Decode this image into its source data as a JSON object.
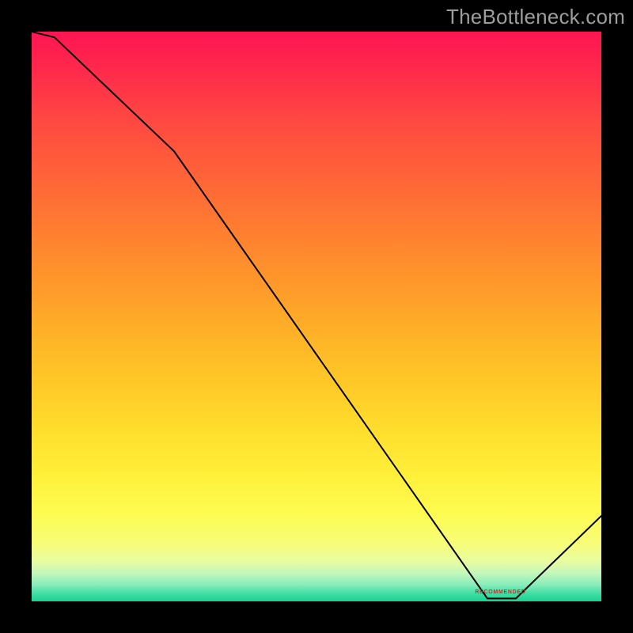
{
  "attribution": "TheBottleneck.com",
  "baseline_label": "RECOMMENDED",
  "chart_data": {
    "type": "line",
    "title": "",
    "xlabel": "",
    "ylabel": "",
    "xlim": [
      0,
      100
    ],
    "ylim": [
      0,
      100
    ],
    "grid": false,
    "x": [
      0,
      4,
      25,
      80,
      85,
      100
    ],
    "values": [
      100,
      99,
      79,
      0.5,
      0.5,
      15
    ],
    "background_gradient": {
      "orientation": "vertical",
      "stops": [
        {
          "pos": 0.0,
          "color": "#ff1552"
        },
        {
          "pos": 0.5,
          "color": "#ffb427"
        },
        {
          "pos": 0.85,
          "color": "#fdfc53"
        },
        {
          "pos": 1.0,
          "color": "#16d393"
        }
      ]
    },
    "annotations": [
      {
        "text": "RECOMMENDED",
        "x": 82,
        "y": 1.5,
        "color": "#e02424"
      }
    ]
  }
}
